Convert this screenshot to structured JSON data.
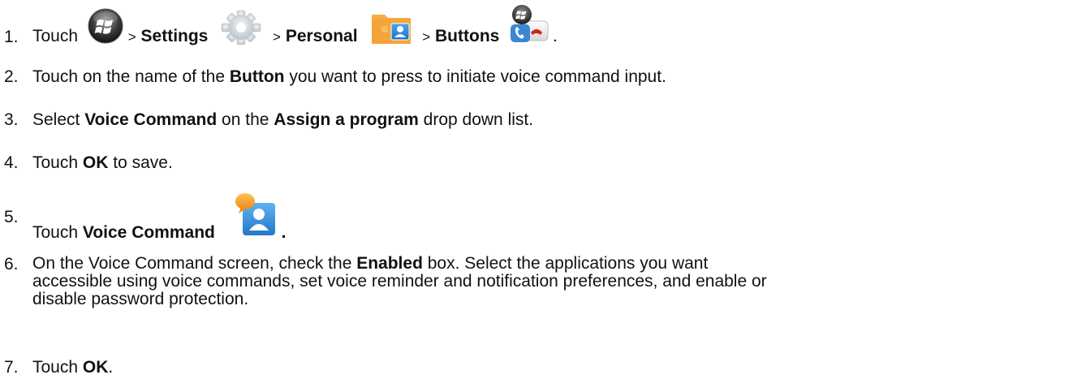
{
  "steps": [
    {
      "number": "1.",
      "parts": {
        "touch": "Touch",
        "sep1": ">",
        "settings": "Settings",
        "sep2": ">",
        "personal": "Personal",
        "sep3": ">",
        "buttons": "Buttons",
        "end": "."
      },
      "icons": [
        "windows-start-icon",
        "settings-gear-icon",
        "personal-folder-icon",
        "buttons-phone-icon"
      ]
    },
    {
      "number": "2.",
      "parts": {
        "a": "Touch on the name of the",
        "b": "Button",
        "c": "you want to press to initiate voice command input."
      }
    },
    {
      "number": "3.",
      "parts": {
        "a": "Select",
        "b": "Voice Command",
        "c": "on the",
        "d": "Assign a program",
        "e": "drop down list."
      }
    },
    {
      "number": "4.",
      "parts": {
        "a": "Touch",
        "b": "OK",
        "c": "to save."
      }
    },
    {
      "number": "5.",
      "parts": {
        "a": "Touch",
        "b": "Voice Command",
        "c": "."
      },
      "icons": [
        "voice-command-icon"
      ]
    },
    {
      "number": "6.",
      "parts": {
        "a": "On the Voice Command screen, check the",
        "b": "Enabled",
        "c": "box. Select the applications you want",
        "line2": "accessible using voice commands, set voice reminder and notification preferences, and enable or",
        "line3": "disable password protection."
      }
    },
    {
      "number": "7.",
      "parts": {
        "a": "Touch",
        "b": "OK",
        "c": "."
      }
    }
  ]
}
